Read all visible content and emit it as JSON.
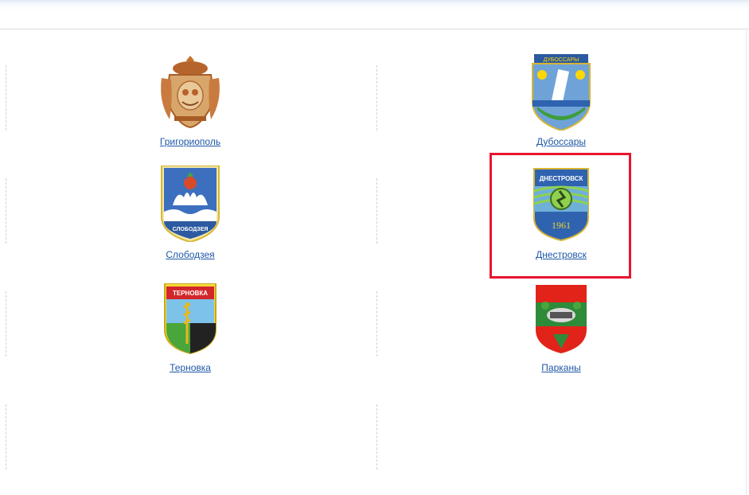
{
  "cities": [
    {
      "name": "Григориополь",
      "icon": "grigoriopol-crest-icon"
    },
    {
      "name": "Дубоссары",
      "icon": "dubossary-crest-icon",
      "crest_text": "ДУБОССАРЫ"
    },
    {
      "name": "Слободзея",
      "icon": "slobodzeya-crest-icon",
      "crest_text": "СЛОБОДЗЕЯ"
    },
    {
      "name": "Днестровск",
      "icon": "dnestrovsk-crest-icon",
      "crest_text": "ДНЕСТРОВСК",
      "crest_year": "1961",
      "highlighted": true
    },
    {
      "name": "Терновка",
      "icon": "ternovka-crest-icon",
      "crest_text": "ТЕРНОВКА"
    },
    {
      "name": "Парканы",
      "icon": "parkany-crest-icon"
    }
  ],
  "colors": {
    "link": "#1f58a8",
    "highlight_border": "#e8152e",
    "separator": "#d0d0d0"
  }
}
